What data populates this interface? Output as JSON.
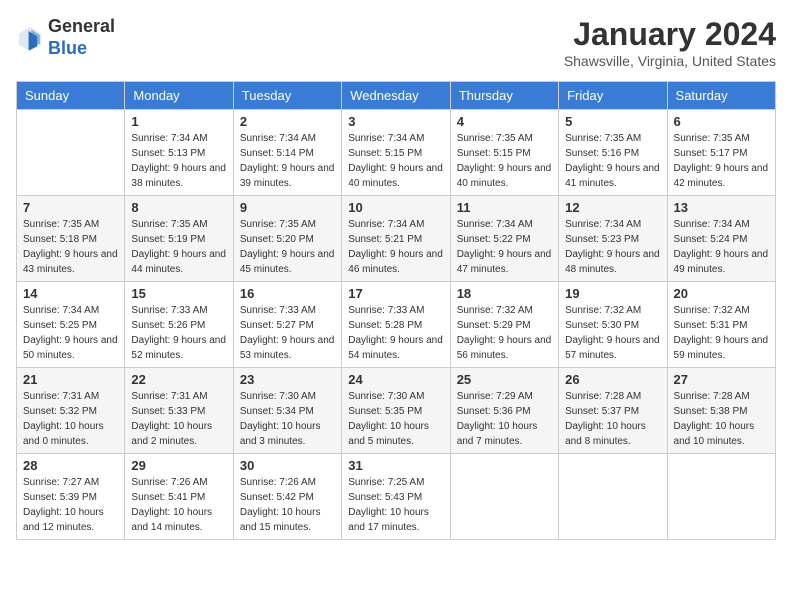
{
  "header": {
    "logo_line1": "General",
    "logo_line2": "Blue",
    "month_title": "January 2024",
    "location": "Shawsville, Virginia, United States"
  },
  "days_of_week": [
    "Sunday",
    "Monday",
    "Tuesday",
    "Wednesday",
    "Thursday",
    "Friday",
    "Saturday"
  ],
  "weeks": [
    [
      {
        "num": "",
        "sunrise": "",
        "sunset": "",
        "daylight": ""
      },
      {
        "num": "1",
        "sunrise": "Sunrise: 7:34 AM",
        "sunset": "Sunset: 5:13 PM",
        "daylight": "Daylight: 9 hours and 38 minutes."
      },
      {
        "num": "2",
        "sunrise": "Sunrise: 7:34 AM",
        "sunset": "Sunset: 5:14 PM",
        "daylight": "Daylight: 9 hours and 39 minutes."
      },
      {
        "num": "3",
        "sunrise": "Sunrise: 7:34 AM",
        "sunset": "Sunset: 5:15 PM",
        "daylight": "Daylight: 9 hours and 40 minutes."
      },
      {
        "num": "4",
        "sunrise": "Sunrise: 7:35 AM",
        "sunset": "Sunset: 5:15 PM",
        "daylight": "Daylight: 9 hours and 40 minutes."
      },
      {
        "num": "5",
        "sunrise": "Sunrise: 7:35 AM",
        "sunset": "Sunset: 5:16 PM",
        "daylight": "Daylight: 9 hours and 41 minutes."
      },
      {
        "num": "6",
        "sunrise": "Sunrise: 7:35 AM",
        "sunset": "Sunset: 5:17 PM",
        "daylight": "Daylight: 9 hours and 42 minutes."
      }
    ],
    [
      {
        "num": "7",
        "sunrise": "Sunrise: 7:35 AM",
        "sunset": "Sunset: 5:18 PM",
        "daylight": "Daylight: 9 hours and 43 minutes."
      },
      {
        "num": "8",
        "sunrise": "Sunrise: 7:35 AM",
        "sunset": "Sunset: 5:19 PM",
        "daylight": "Daylight: 9 hours and 44 minutes."
      },
      {
        "num": "9",
        "sunrise": "Sunrise: 7:35 AM",
        "sunset": "Sunset: 5:20 PM",
        "daylight": "Daylight: 9 hours and 45 minutes."
      },
      {
        "num": "10",
        "sunrise": "Sunrise: 7:34 AM",
        "sunset": "Sunset: 5:21 PM",
        "daylight": "Daylight: 9 hours and 46 minutes."
      },
      {
        "num": "11",
        "sunrise": "Sunrise: 7:34 AM",
        "sunset": "Sunset: 5:22 PM",
        "daylight": "Daylight: 9 hours and 47 minutes."
      },
      {
        "num": "12",
        "sunrise": "Sunrise: 7:34 AM",
        "sunset": "Sunset: 5:23 PM",
        "daylight": "Daylight: 9 hours and 48 minutes."
      },
      {
        "num": "13",
        "sunrise": "Sunrise: 7:34 AM",
        "sunset": "Sunset: 5:24 PM",
        "daylight": "Daylight: 9 hours and 49 minutes."
      }
    ],
    [
      {
        "num": "14",
        "sunrise": "Sunrise: 7:34 AM",
        "sunset": "Sunset: 5:25 PM",
        "daylight": "Daylight: 9 hours and 50 minutes."
      },
      {
        "num": "15",
        "sunrise": "Sunrise: 7:33 AM",
        "sunset": "Sunset: 5:26 PM",
        "daylight": "Daylight: 9 hours and 52 minutes."
      },
      {
        "num": "16",
        "sunrise": "Sunrise: 7:33 AM",
        "sunset": "Sunset: 5:27 PM",
        "daylight": "Daylight: 9 hours and 53 minutes."
      },
      {
        "num": "17",
        "sunrise": "Sunrise: 7:33 AM",
        "sunset": "Sunset: 5:28 PM",
        "daylight": "Daylight: 9 hours and 54 minutes."
      },
      {
        "num": "18",
        "sunrise": "Sunrise: 7:32 AM",
        "sunset": "Sunset: 5:29 PM",
        "daylight": "Daylight: 9 hours and 56 minutes."
      },
      {
        "num": "19",
        "sunrise": "Sunrise: 7:32 AM",
        "sunset": "Sunset: 5:30 PM",
        "daylight": "Daylight: 9 hours and 57 minutes."
      },
      {
        "num": "20",
        "sunrise": "Sunrise: 7:32 AM",
        "sunset": "Sunset: 5:31 PM",
        "daylight": "Daylight: 9 hours and 59 minutes."
      }
    ],
    [
      {
        "num": "21",
        "sunrise": "Sunrise: 7:31 AM",
        "sunset": "Sunset: 5:32 PM",
        "daylight": "Daylight: 10 hours and 0 minutes."
      },
      {
        "num": "22",
        "sunrise": "Sunrise: 7:31 AM",
        "sunset": "Sunset: 5:33 PM",
        "daylight": "Daylight: 10 hours and 2 minutes."
      },
      {
        "num": "23",
        "sunrise": "Sunrise: 7:30 AM",
        "sunset": "Sunset: 5:34 PM",
        "daylight": "Daylight: 10 hours and 3 minutes."
      },
      {
        "num": "24",
        "sunrise": "Sunrise: 7:30 AM",
        "sunset": "Sunset: 5:35 PM",
        "daylight": "Daylight: 10 hours and 5 minutes."
      },
      {
        "num": "25",
        "sunrise": "Sunrise: 7:29 AM",
        "sunset": "Sunset: 5:36 PM",
        "daylight": "Daylight: 10 hours and 7 minutes."
      },
      {
        "num": "26",
        "sunrise": "Sunrise: 7:28 AM",
        "sunset": "Sunset: 5:37 PM",
        "daylight": "Daylight: 10 hours and 8 minutes."
      },
      {
        "num": "27",
        "sunrise": "Sunrise: 7:28 AM",
        "sunset": "Sunset: 5:38 PM",
        "daylight": "Daylight: 10 hours and 10 minutes."
      }
    ],
    [
      {
        "num": "28",
        "sunrise": "Sunrise: 7:27 AM",
        "sunset": "Sunset: 5:39 PM",
        "daylight": "Daylight: 10 hours and 12 minutes."
      },
      {
        "num": "29",
        "sunrise": "Sunrise: 7:26 AM",
        "sunset": "Sunset: 5:41 PM",
        "daylight": "Daylight: 10 hours and 14 minutes."
      },
      {
        "num": "30",
        "sunrise": "Sunrise: 7:26 AM",
        "sunset": "Sunset: 5:42 PM",
        "daylight": "Daylight: 10 hours and 15 minutes."
      },
      {
        "num": "31",
        "sunrise": "Sunrise: 7:25 AM",
        "sunset": "Sunset: 5:43 PM",
        "daylight": "Daylight: 10 hours and 17 minutes."
      },
      {
        "num": "",
        "sunrise": "",
        "sunset": "",
        "daylight": ""
      },
      {
        "num": "",
        "sunrise": "",
        "sunset": "",
        "daylight": ""
      },
      {
        "num": "",
        "sunrise": "",
        "sunset": "",
        "daylight": ""
      }
    ]
  ]
}
